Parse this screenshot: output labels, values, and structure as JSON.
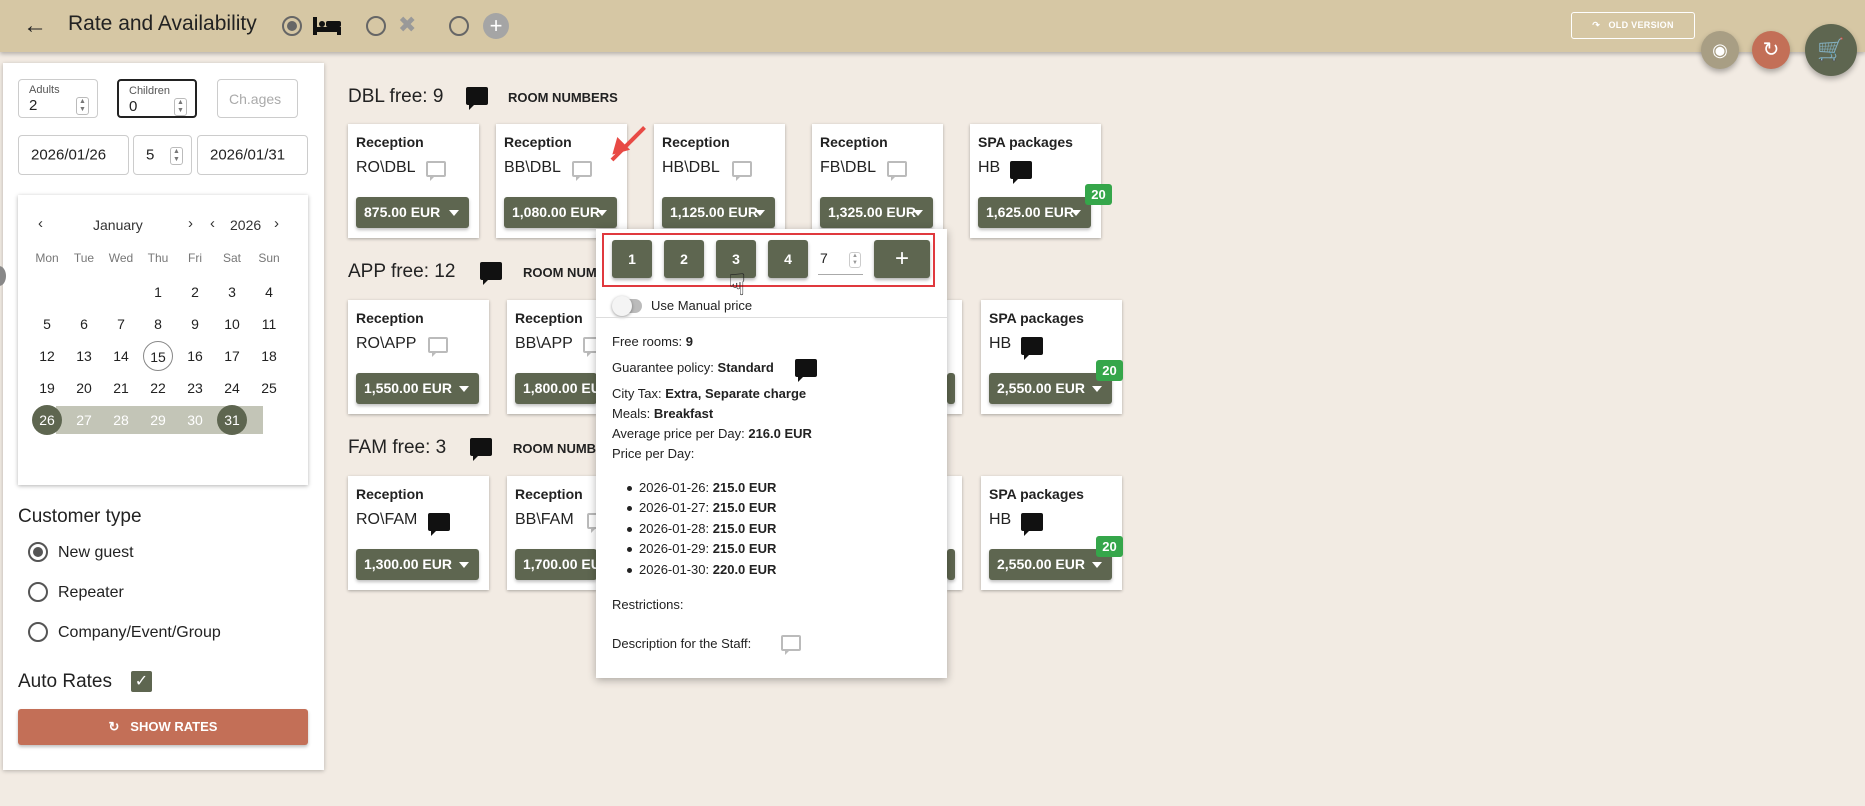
{
  "header": {
    "title": "Rate and Availability",
    "old_version_label": "OLD VERSION",
    "colors": {
      "bar": "#d6c7a4",
      "accent": "#5e6650",
      "danger": "#c36f57"
    }
  },
  "search": {
    "adults_label": "Adults",
    "adults_value": "2",
    "children_label": "Children",
    "children_value": "0",
    "ch_ages_placeholder": "Ch.ages",
    "arrival": "2026/01/26",
    "nights": "5",
    "departure": "2026/01/31"
  },
  "calendar": {
    "month": "January",
    "year": "2026",
    "weekdays": [
      "Mon",
      "Tue",
      "Wed",
      "Thu",
      "Fri",
      "Sat",
      "Sun"
    ],
    "days": [
      "1",
      "2",
      "3",
      "4",
      "5",
      "6",
      "7",
      "8",
      "9",
      "10",
      "11",
      "12",
      "13",
      "14",
      "15",
      "16",
      "17",
      "18",
      "19",
      "20",
      "21",
      "22",
      "23",
      "24",
      "25",
      "26",
      "27",
      "28",
      "29",
      "30",
      "31"
    ]
  },
  "customer": {
    "title": "Customer type",
    "options": [
      "New guest",
      "Repeater",
      "Company/Event/Group"
    ],
    "selected": "New guest"
  },
  "auto_rates": {
    "label": "Auto Rates",
    "checked": true
  },
  "show_rates_label": "SHOW RATES",
  "rooms": [
    {
      "title": "DBL free: 9",
      "room_numbers_label": "ROOM NUMBERS",
      "cards": [
        {
          "title": "Reception",
          "code": "RO\\DBL",
          "price": "875.00 EUR"
        },
        {
          "title": "Reception",
          "code": "BB\\DBL",
          "price": "1,080.00 EUR"
        },
        {
          "title": "Reception",
          "code": "HB\\DBL",
          "price": "1,125.00 EUR"
        },
        {
          "title": "Reception",
          "code": "FB\\DBL",
          "price": "1,325.00 EUR"
        },
        {
          "title": "SPA packages",
          "code": "HB",
          "price": "1,625.00 EUR",
          "badge": "20"
        }
      ]
    },
    {
      "title": "APP free: 12",
      "room_numbers_label": "ROOM NUMBERS",
      "cards": [
        {
          "title": "Reception",
          "code": "RO\\APP",
          "price": "1,550.00 EUR"
        },
        {
          "title": "Reception",
          "code": "BB\\APP",
          "price": "1,800.00 EUR"
        },
        {
          "title": "SPA packages",
          "code": "HB",
          "price": "2,550.00 EUR",
          "badge": "20"
        }
      ]
    },
    {
      "title": "FAM free: 3",
      "room_numbers_label": "ROOM NUMBERS",
      "cards": [
        {
          "title": "Reception",
          "code": "RO\\FAM",
          "price": "1,300.00 EUR"
        },
        {
          "title": "Reception",
          "code": "BB\\FAM",
          "price": "1,700.00 EUR"
        },
        {
          "title": "SPA packages",
          "code": "HB",
          "price": "2,550.00 EUR",
          "badge": "20"
        }
      ]
    }
  ],
  "popup": {
    "room_buttons": [
      "1",
      "2",
      "3",
      "4"
    ],
    "room_input_value": "7",
    "manual_price_label": "Use Manual price",
    "free_rooms_label": "Free rooms:",
    "free_rooms_value": "9",
    "guarantee_label": "Guarantee policy:",
    "guarantee_value": "Standard",
    "city_tax_label": "City Tax:",
    "city_tax_value": "Extra, Separate charge",
    "meals_label": "Meals:",
    "meals_value": "Breakfast",
    "avg_label": "Average price per Day:",
    "avg_value": "216.0 EUR",
    "price_per_day_label": "Price per Day:",
    "prices": [
      {
        "date": "2026-01-26:",
        "price": "215.0 EUR"
      },
      {
        "date": "2026-01-27:",
        "price": "215.0 EUR"
      },
      {
        "date": "2026-01-28:",
        "price": "215.0 EUR"
      },
      {
        "date": "2026-01-29:",
        "price": "215.0 EUR"
      },
      {
        "date": "2026-01-30:",
        "price": "220.0 EUR"
      }
    ],
    "restrictions_label": "Restrictions:",
    "staff_desc_label": "Description for the Staff:"
  }
}
